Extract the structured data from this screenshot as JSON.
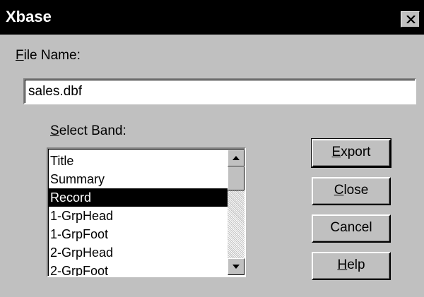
{
  "window": {
    "title": "Xbase"
  },
  "file_name": {
    "label_mnemonic": "F",
    "label_rest": "ile Name:",
    "value": "sales.dbf"
  },
  "select_band": {
    "label_mnemonic": "S",
    "label_rest": "elect Band:",
    "items": [
      {
        "label": "Title"
      },
      {
        "label": "Summary"
      },
      {
        "label": "Record"
      },
      {
        "label": "1-GrpHead"
      },
      {
        "label": "1-GrpFoot"
      },
      {
        "label": "2-GrpHead"
      },
      {
        "label": "2-GrpFoot"
      }
    ],
    "selected": "Record"
  },
  "buttons": {
    "export": {
      "mnemonic": "E",
      "rest": "xport"
    },
    "close": {
      "mnemonic": "C",
      "rest": "lose"
    },
    "cancel": {
      "label": "Cancel"
    },
    "help": {
      "mnemonic": "H",
      "rest": "elp"
    }
  },
  "icons": {
    "close": "close-icon",
    "scroll_up": "triangle-up-icon",
    "scroll_down": "triangle-down-icon"
  },
  "colors": {
    "title_bar": "#000000",
    "face": "#c0c0c0",
    "selection": "#000000"
  }
}
